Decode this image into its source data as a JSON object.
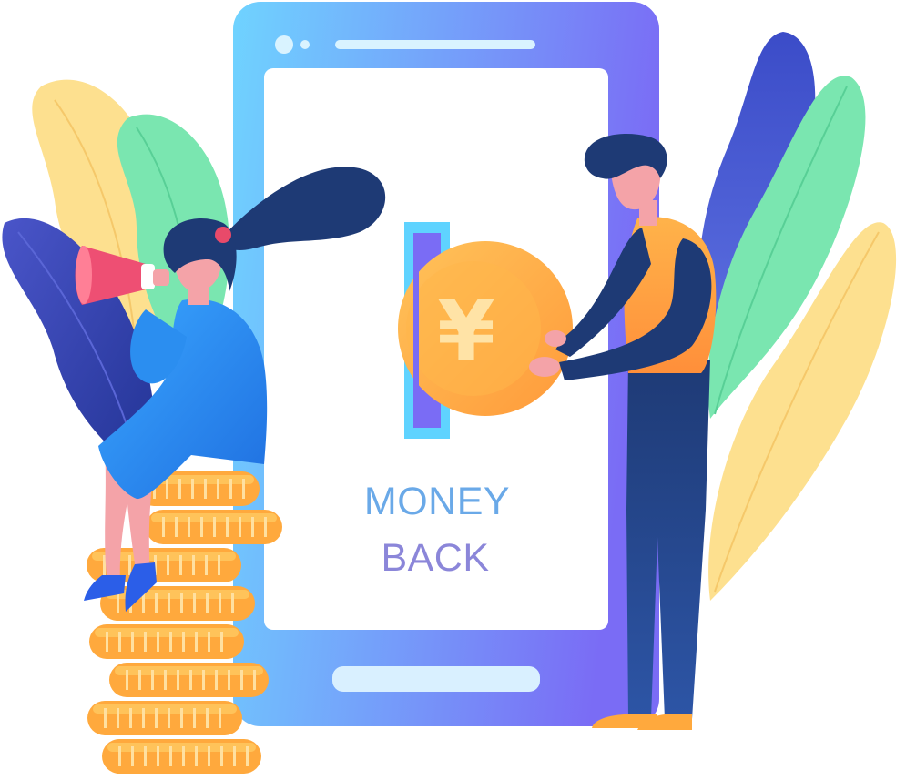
{
  "screen_text": {
    "line1": "MONEY",
    "line2": "BACK"
  },
  "coin_symbol": "¥",
  "colors": {
    "phone_gradient_start": "#6fd3ff",
    "phone_gradient_end": "#7a6cf5",
    "screen_bg": "#ffffff",
    "text_line1": "#6aa9e8",
    "text_line2": "#8b86d9",
    "coin_orange": "#ffa93d",
    "leaf_yellow": "#fde08f",
    "leaf_green": "#7ae6b0",
    "leaf_navy": "#2e3da0",
    "figure_navy": "#1e3a75",
    "woman_dress": "#2b8ef0"
  },
  "icons": {
    "phone": "smartphone-icon",
    "coin": "yuan-coin-icon",
    "megaphone": "megaphone-icon",
    "coin_stack": "coin-stack-icon"
  }
}
